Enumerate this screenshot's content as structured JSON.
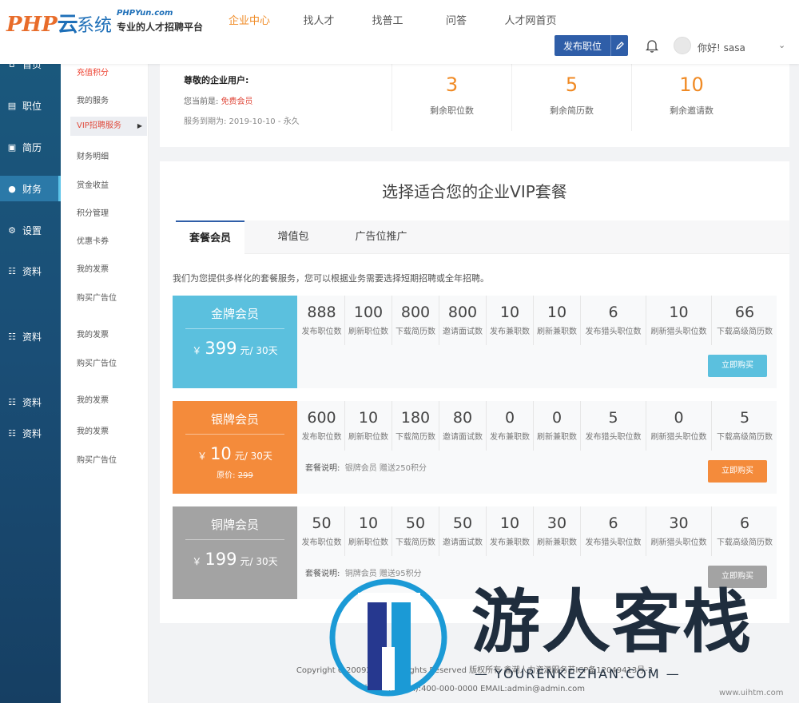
{
  "header": {
    "logo_php": "PHP",
    "logo_cloud": "云",
    "logo_sys": "系统",
    "logo_url": "PHPYun.com",
    "logo_tagline": "专业的人才招聘平台",
    "nav": [
      "企业中心",
      "找人才",
      "找普工",
      "问答",
      "人才网首页"
    ],
    "publish_label": "发布职位",
    "greeting": "你好! sasa"
  },
  "sidebar_main": [
    {
      "label": "首页",
      "icon": "home-icon"
    },
    {
      "label": "职位",
      "icon": "briefcase-icon"
    },
    {
      "label": "简历",
      "icon": "resume-icon"
    },
    {
      "label": "财务",
      "icon": "finance-icon"
    },
    {
      "label": "设置",
      "icon": "gear-icon"
    },
    {
      "label": "资料",
      "icon": "profile-icon"
    },
    {
      "label": "资料",
      "icon": "profile-icon"
    },
    {
      "label": "资料",
      "icon": "profile-icon"
    },
    {
      "label": "资料",
      "icon": "profile-icon"
    }
  ],
  "sidebar_sub": [
    "充值积分",
    "我的服务",
    "VIP招聘服务",
    "财务明细",
    "赏金收益",
    "积分管理",
    "优惠卡券",
    "我的发票",
    "购买广告位",
    "我的发票",
    "购买广告位",
    "我的发票",
    "我的发票",
    "购买广告位"
  ],
  "account": {
    "greeting": "尊敬的企业用户:",
    "current_label": "您当前是:",
    "current_level": "免费会员",
    "expire": "服务到期为:   2019-10-10 - 永久",
    "stats": [
      {
        "value": "3",
        "label": "剩余职位数"
      },
      {
        "value": "5",
        "label": "剩余简历数"
      },
      {
        "value": "10",
        "label": "剩余邀请数"
      }
    ]
  },
  "packages": {
    "title": "选择适合您的企业VIP套餐",
    "tabs": [
      "套餐会员",
      "增值包",
      "广告位推广"
    ],
    "description": "我们为您提供多样化的套餐服务，您可以根据业务需要选择短期招聘或全年招聘。",
    "plans": [
      {
        "name": "金牌会员",
        "currency": "￥",
        "price": "399",
        "unit": "元/ 30天",
        "original": "",
        "note_label": "",
        "note": "",
        "color": "#5bc0de",
        "button": "立即购买",
        "button_color": "#5bc0de",
        "stats": [
          {
            "value": "888",
            "label": "发布职位数"
          },
          {
            "value": "100",
            "label": "刷新职位数"
          },
          {
            "value": "800",
            "label": "下载简历数"
          },
          {
            "value": "800",
            "label": "邀请面试数"
          },
          {
            "value": "10",
            "label": "发布兼职数"
          },
          {
            "value": "10",
            "label": "刷新兼职数"
          },
          {
            "value": "6",
            "label": "发布猎头职位数"
          },
          {
            "value": "10",
            "label": "刷新猎头职位数"
          },
          {
            "value": "66",
            "label": "下载高级简历数"
          }
        ]
      },
      {
        "name": "银牌会员",
        "currency": "￥",
        "price": "10",
        "unit": "元/ 30天",
        "original_label": "原价:",
        "original": "299",
        "note_label": "套餐说明:",
        "note": "银牌会员 赠送250积分",
        "color": "#f48b3b",
        "button": "立即购买",
        "button_color": "#f48b3b",
        "stats": [
          {
            "value": "600",
            "label": "发布职位数"
          },
          {
            "value": "10",
            "label": "刷新职位数"
          },
          {
            "value": "180",
            "label": "下载简历数"
          },
          {
            "value": "80",
            "label": "邀请面试数"
          },
          {
            "value": "0",
            "label": "发布兼职数"
          },
          {
            "value": "0",
            "label": "刷新兼职数"
          },
          {
            "value": "5",
            "label": "发布猎头职位数"
          },
          {
            "value": "0",
            "label": "刷新猎头职位数"
          },
          {
            "value": "5",
            "label": "下载高级简历数"
          }
        ]
      },
      {
        "name": "铜牌会员",
        "currency": "￥",
        "price": "199",
        "unit": "元/ 30天",
        "original": "",
        "note_label": "套餐说明:",
        "note": "铜牌会员 赠送95积分",
        "color": "#a3a3a3",
        "button": "立即购买",
        "button_color": "#a3a3a3",
        "stats": [
          {
            "value": "50",
            "label": "发布职位数"
          },
          {
            "value": "10",
            "label": "刷新职位数"
          },
          {
            "value": "50",
            "label": "下载简历数"
          },
          {
            "value": "50",
            "label": "邀请面试数"
          },
          {
            "value": "10",
            "label": "发布兼职数"
          },
          {
            "value": "30",
            "label": "刷新兼职数"
          },
          {
            "value": "6",
            "label": "发布猎头职位数"
          },
          {
            "value": "30",
            "label": "刷新猎头职位数"
          },
          {
            "value": "6",
            "label": "下载高级简历数"
          }
        ]
      }
    ]
  },
  "footer": {
    "copyright": "Copyright C 20092014 All Rights Reserved 版权所有 鑫潮人力资源服务苏ICP备12049413号-3",
    "address": "地址: 电话(Tel):400-000-0000 EMAIL:admin@admin.com"
  },
  "watermark": {
    "chinese": "游人客栈",
    "english": "— YOURENKEZHAN.COM —",
    "url": "www.uihtm.com"
  },
  "colors": {
    "accent": "#f08a24",
    "primary": "#2f5ea8",
    "sidebar": "#1a4e76"
  }
}
